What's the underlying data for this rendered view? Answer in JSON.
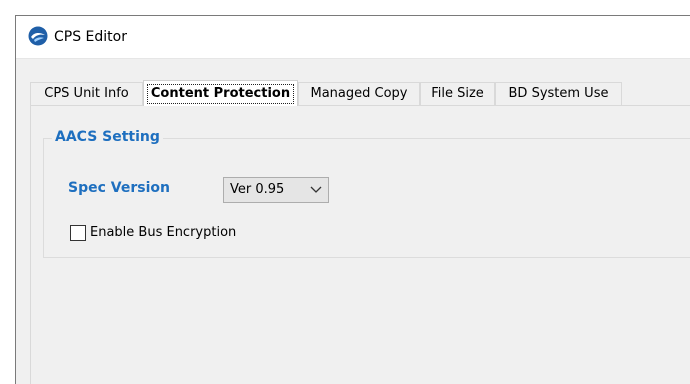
{
  "window": {
    "title": "CPS Editor",
    "icon": "cps-editor-app-icon"
  },
  "tabs": [
    {
      "label": "CPS Unit Info",
      "active": false
    },
    {
      "label": "Content Protection",
      "active": true
    },
    {
      "label": "Managed Copy",
      "active": false
    },
    {
      "label": "File Size",
      "active": false
    },
    {
      "label": "BD System Use",
      "active": false
    }
  ],
  "aacs": {
    "group_title": "AACS Setting",
    "spec_version_label": "Spec Version",
    "spec_version_value": "Ver 0.95",
    "bus_encryption_label": "Enable Bus Encryption",
    "bus_encryption_checked": false
  },
  "colors": {
    "accent_label": "#1e6fbf",
    "panel_bg": "#f0f0f0"
  }
}
